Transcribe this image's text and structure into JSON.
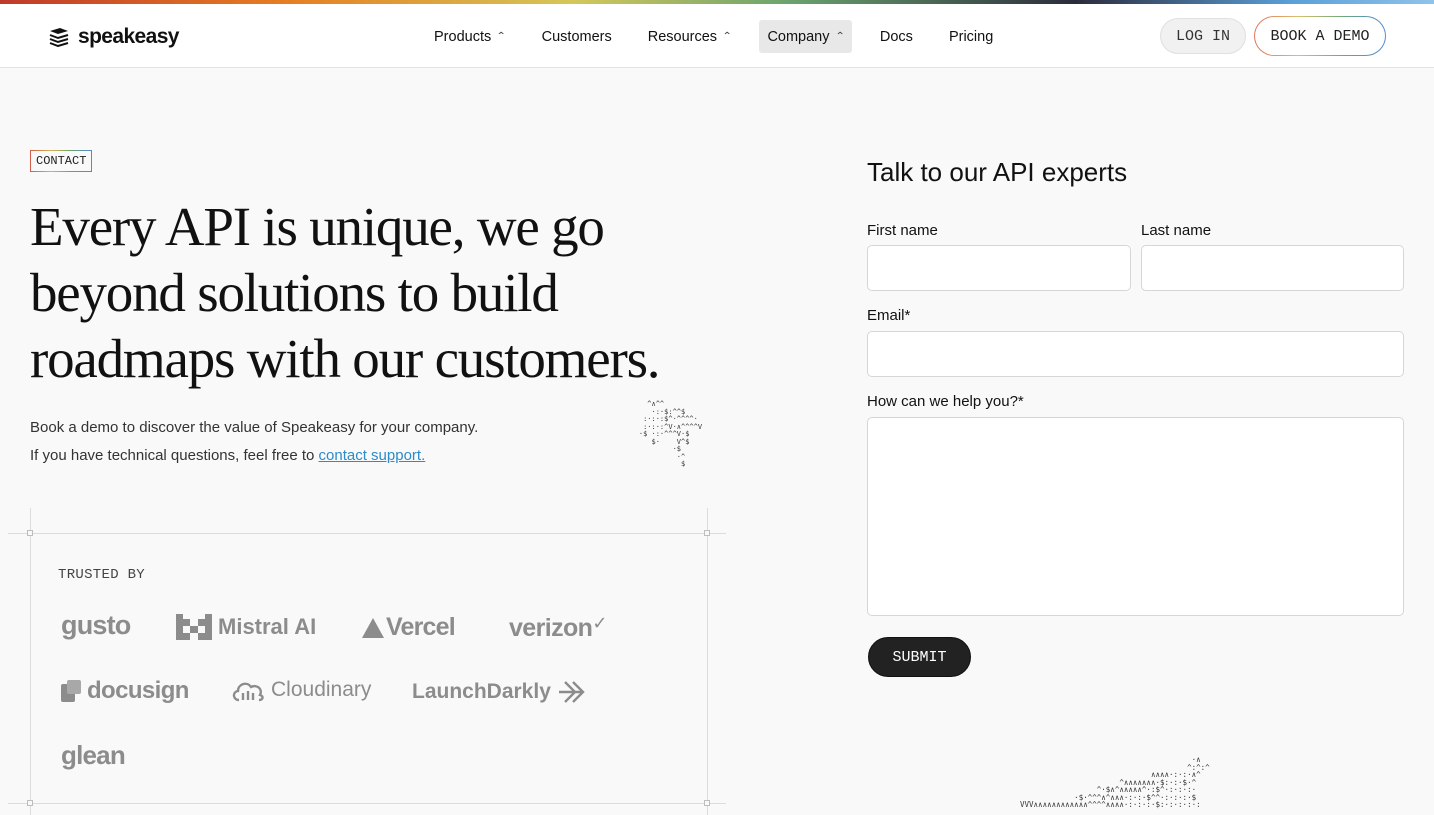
{
  "header": {
    "brand": "speakeasy",
    "nav": [
      {
        "label": "Products",
        "has_menu": true
      },
      {
        "label": "Customers",
        "has_menu": false
      },
      {
        "label": "Resources",
        "has_menu": true
      },
      {
        "label": "Company",
        "has_menu": true,
        "active": true
      },
      {
        "label": "Docs",
        "has_menu": false
      },
      {
        "label": "Pricing",
        "has_menu": false
      }
    ],
    "login_label": "LOG IN",
    "demo_label": "BOOK A DEMO"
  },
  "hero": {
    "tag": "CONTACT",
    "headline": "Every API is unique, we go beyond solutions to build roadmaps with our customers.",
    "description_line1": "Book a demo to discover the value of Speakeasy for your company.",
    "description_line2_prefix": "If you have technical questions, feel free to ",
    "support_link": "contact support."
  },
  "trusted": {
    "label": "TRUSTED BY",
    "brands": [
      "gusto",
      "Mistral AI",
      "Vercel",
      "verizon",
      "docusign",
      "Cloudinary",
      "LaunchDarkly",
      "glean"
    ]
  },
  "form": {
    "title": "Talk to our API experts",
    "first_name_label": "First name",
    "first_name_value": "",
    "last_name_label": "Last name",
    "last_name_value": "",
    "email_label": "Email*",
    "email_value": "",
    "message_label": "How can we help you?*",
    "message_value": "",
    "submit_label": "SUBMIT"
  },
  "colors": {
    "accent_link": "#2d8bc9",
    "submit_bg": "#222222",
    "page_bg": "#f9f9f9"
  }
}
